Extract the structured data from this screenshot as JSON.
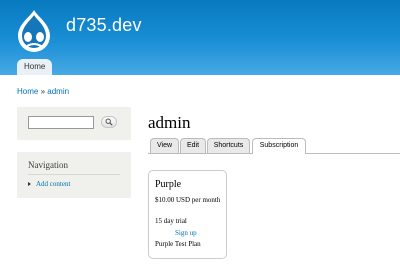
{
  "site": {
    "name": "d735.dev",
    "logo_icon": "drupal-drop-icon"
  },
  "main_menu": {
    "home_label": "Home"
  },
  "breadcrumb": {
    "home": "Home",
    "separator": "»",
    "current": "admin"
  },
  "search": {
    "value": "",
    "button_icon": "search-icon"
  },
  "navigation": {
    "title": "Navigation",
    "items": [
      "Add content"
    ]
  },
  "page": {
    "title": "admin"
  },
  "tabs": [
    "View",
    "Edit",
    "Shortcuts",
    "Subscription"
  ],
  "active_tab": "Subscription",
  "plan": {
    "name": "Purple",
    "price": "$10.00 USD per month",
    "trial": "15 day trial",
    "signup_label": "Sign up",
    "description": "Purple Test Plan"
  },
  "colors": {
    "header": "#1a8fd6",
    "link": "#0071b3",
    "sidebar_block": "#f0f0ec"
  }
}
